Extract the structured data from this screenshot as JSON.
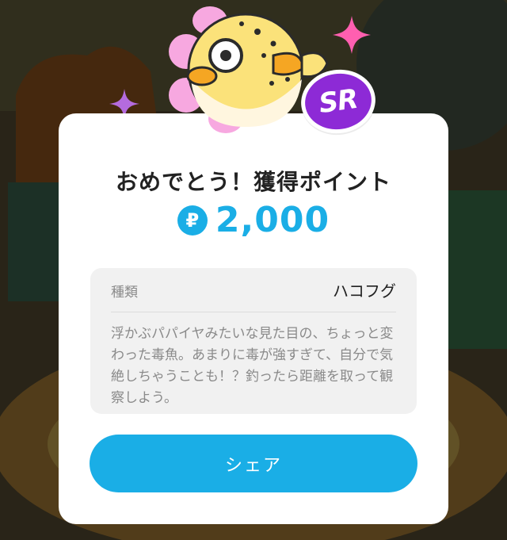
{
  "colors": {
    "accent": "#1aaee6",
    "rarity_badge": "#8d2ad6",
    "card_background": "#ffffff",
    "info_box_background": "#f1f1f1",
    "sparkle_pink": "#ff5fb0",
    "sparkle_purple": "#b46bde"
  },
  "reward": {
    "title": "おめでとう！獲得ポイント",
    "points_icon_glyph": "₽",
    "points_value": "2,000",
    "rarity": "SR"
  },
  "item": {
    "category_label": "種類",
    "category_value": "ハコフグ",
    "description": "浮かぶパパイヤみたいな見た目の、ちょっと変わった毒魚。あまりに毒が強すぎて、自分で気絶しちゃうことも！？釣ったら距離を取って観察しよう。"
  },
  "actions": {
    "share_label": "シェア"
  },
  "icons": {
    "mascot": "boxfish-illustration",
    "points": "point-coin-icon",
    "sparkles": "sparkle-icon"
  }
}
